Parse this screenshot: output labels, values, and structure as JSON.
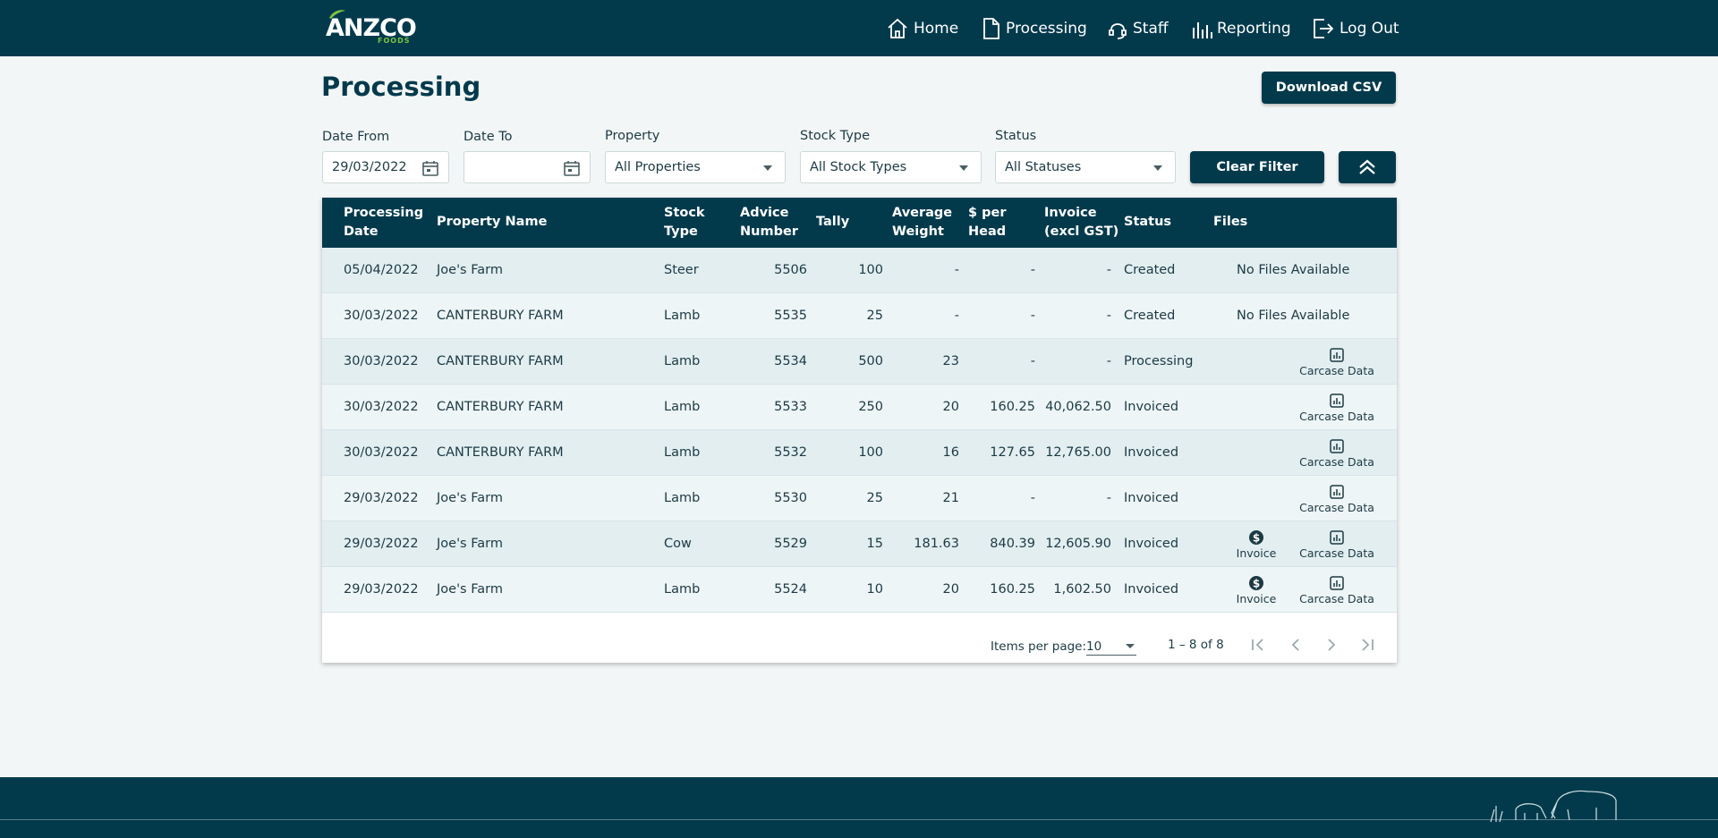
{
  "header": {
    "logo_text": "ANZCO",
    "logo_sub": "FOODS",
    "nav": [
      {
        "label": "Home",
        "icon": "home-icon"
      },
      {
        "label": "Processing",
        "icon": "document-icon"
      },
      {
        "label": "Staff",
        "icon": "staff-icon"
      },
      {
        "label": "Reporting",
        "icon": "bar-chart-icon"
      },
      {
        "label": "Log Out",
        "icon": "logout-icon"
      }
    ]
  },
  "page": {
    "title": "Processing",
    "download_csv": "Download CSV"
  },
  "filters": {
    "date_from_label": "Date From",
    "date_from_value": "29/03/2022",
    "date_to_label": "Date To",
    "date_to_value": "",
    "property_label": "Property",
    "property_value": "All Properties",
    "stock_type_label": "Stock Type",
    "stock_type_value": "All Stock Types",
    "status_label": "Status",
    "status_value": "All Statuses",
    "clear_filter": "Clear Filter"
  },
  "table": {
    "headers": {
      "processing_date_1": "Processing",
      "processing_date_2": "Date",
      "property_name": "Property Name",
      "stock_type_1": "Stock",
      "stock_type_2": "Type",
      "advice_number_1": "Advice",
      "advice_number_2": "Number",
      "tally": "Tally",
      "avg_weight_1": "Average",
      "avg_weight_2": "Weight",
      "per_head_1": "$ per",
      "per_head_2": "Head",
      "invoice_1": "Invoice",
      "invoice_2": "(excl GST)",
      "status": "Status",
      "files": "Files"
    },
    "no_files_label": "No Files Available",
    "invoice_label": "Invoice",
    "carcase_label": "Carcase Data",
    "rows": [
      {
        "date": "05/04/2022",
        "property": "Joe's Farm",
        "stock": "Steer",
        "advice": "5506",
        "tally": "100",
        "weight": "-",
        "per_head": "-",
        "invoice": "-",
        "status": "Created",
        "files": "none"
      },
      {
        "date": "30/03/2022",
        "property": "CANTERBURY FARM",
        "stock": "Lamb",
        "advice": "5535",
        "tally": "25",
        "weight": "-",
        "per_head": "-",
        "invoice": "-",
        "status": "Created",
        "files": "none"
      },
      {
        "date": "30/03/2022",
        "property": "CANTERBURY FARM",
        "stock": "Lamb",
        "advice": "5534",
        "tally": "500",
        "weight": "23",
        "per_head": "-",
        "invoice": "-",
        "status": "Processing",
        "files": "carcase"
      },
      {
        "date": "30/03/2022",
        "property": "CANTERBURY FARM",
        "stock": "Lamb",
        "advice": "5533",
        "tally": "250",
        "weight": "20",
        "per_head": "160.25",
        "invoice": "40,062.50",
        "status": "Invoiced",
        "files": "carcase"
      },
      {
        "date": "30/03/2022",
        "property": "CANTERBURY FARM",
        "stock": "Lamb",
        "advice": "5532",
        "tally": "100",
        "weight": "16",
        "per_head": "127.65",
        "invoice": "12,765.00",
        "status": "Invoiced",
        "files": "carcase"
      },
      {
        "date": "29/03/2022",
        "property": "Joe's Farm",
        "stock": "Lamb",
        "advice": "5530",
        "tally": "25",
        "weight": "21",
        "per_head": "-",
        "invoice": "-",
        "status": "Invoiced",
        "files": "carcase"
      },
      {
        "date": "29/03/2022",
        "property": "Joe's Farm",
        "stock": "Cow",
        "advice": "5529",
        "tally": "15",
        "weight": "181.63",
        "per_head": "840.39",
        "invoice": "12,605.90",
        "status": "Invoiced",
        "files": "both"
      },
      {
        "date": "29/03/2022",
        "property": "Joe's Farm",
        "stock": "Lamb",
        "advice": "5524",
        "tally": "10",
        "weight": "20",
        "per_head": "160.25",
        "invoice": "1,602.50",
        "status": "Invoiced",
        "files": "both"
      }
    ]
  },
  "paginator": {
    "items_per_page_label": "Items per page:",
    "items_per_page_value": "10",
    "range_label": "1 – 8 of 8"
  },
  "colors": {
    "primary": "#023a4c",
    "accent_green": "#7dc242",
    "row_odd": "#e2eef0",
    "row_even": "#eef5f6"
  }
}
